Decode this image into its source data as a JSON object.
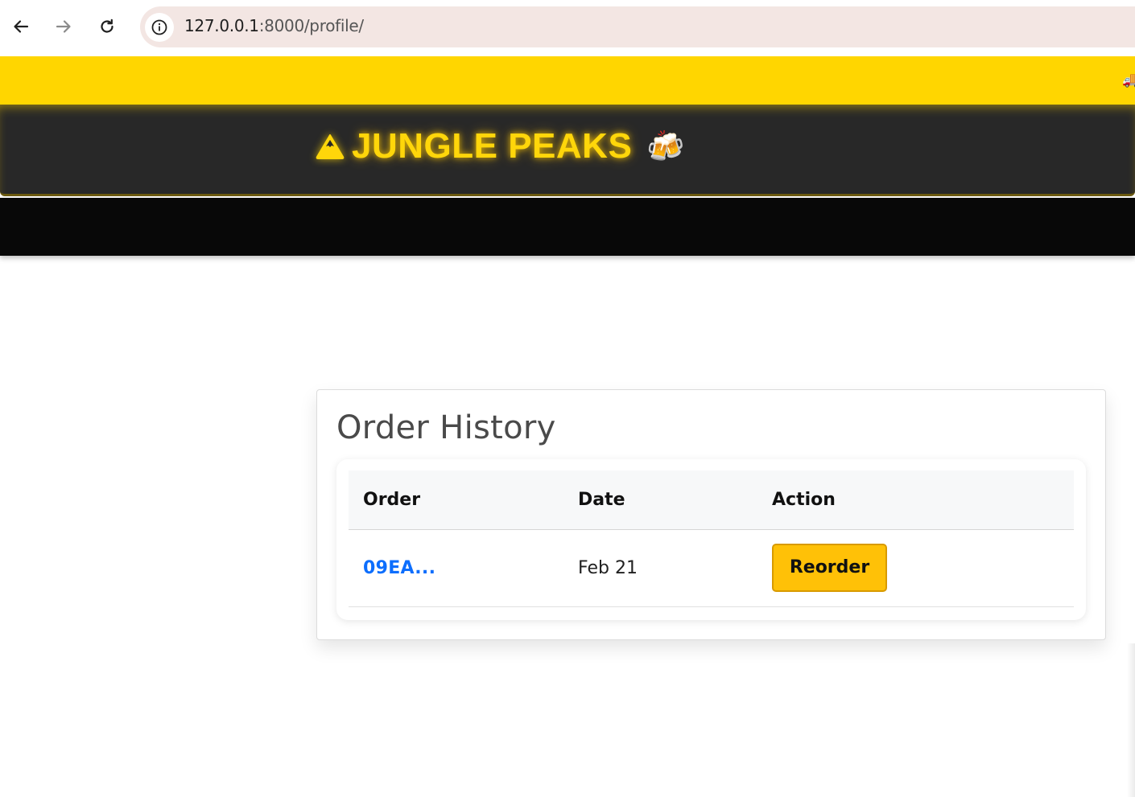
{
  "browser": {
    "url_host": "127.0.0.1",
    "url_path": ":8000/profile/",
    "back_icon": "arrow-left-icon",
    "forward_icon": "arrow-right-icon",
    "reload_icon": "reload-icon",
    "info_icon": "info-icon"
  },
  "promo": {
    "icon": "delivery-truck-icon",
    "glyph": "🚚"
  },
  "header": {
    "brand_icon": "mountain-icon",
    "brand_name": "JUNGLE PEAKS",
    "beer_glyph": "🍻",
    "beer_icon": "beer-mugs-icon"
  },
  "colors": {
    "promo_yellow": "#ffd600",
    "header_dark": "#282828",
    "nav_black": "#080808",
    "brand_yellow": "#ffd60a",
    "link_blue": "#0d6efd",
    "button_yellow": "#ffc107"
  },
  "order_history": {
    "title": "Order History",
    "columns": [
      "Order",
      "Date",
      "Action"
    ],
    "rows": [
      {
        "order": "09EA...",
        "date": "Feb 21",
        "action": "Reorder"
      }
    ]
  }
}
